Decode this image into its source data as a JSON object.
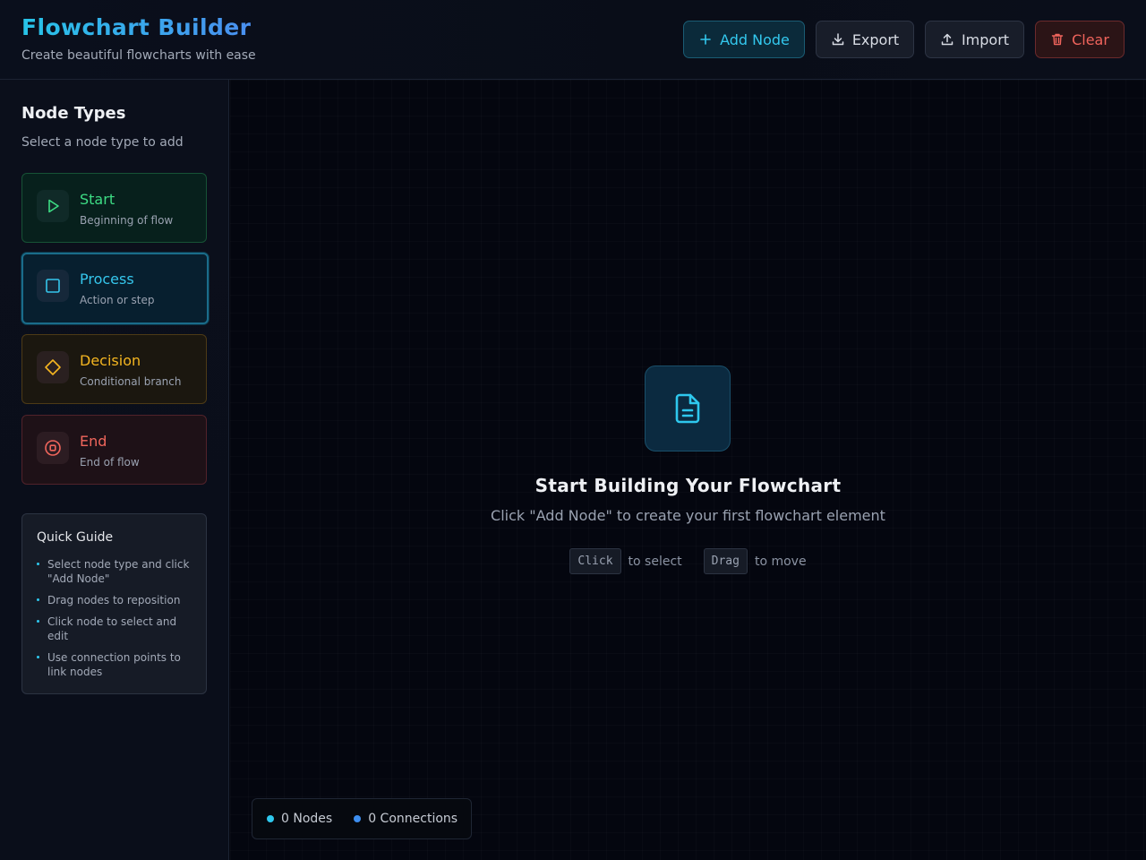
{
  "header": {
    "title": "Flowchart Builder",
    "subtitle": "Create beautiful flowcharts with ease",
    "buttons": {
      "add": "Add Node",
      "export": "Export",
      "import": "Import",
      "clear": "Clear"
    }
  },
  "sidebar": {
    "title": "Node Types",
    "subtitle": "Select a node type to add",
    "node_types": [
      {
        "label": "Start",
        "description": "Beginning of flow",
        "icon": "play-icon",
        "color": "#3ddc84"
      },
      {
        "label": "Process",
        "description": "Action or step",
        "icon": "square-icon",
        "color": "#35c6ec",
        "selected": true
      },
      {
        "label": "Decision",
        "description": "Conditional branch",
        "icon": "diamond-icon",
        "color": "#f4b520"
      },
      {
        "label": "End",
        "description": "End of flow",
        "icon": "stop-circle-icon",
        "color": "#f0665c"
      }
    ],
    "guide": {
      "title": "Quick Guide",
      "items": [
        "Select node type and click \"Add Node\"",
        "Drag nodes to reposition",
        "Click node to select and edit",
        "Use connection points to link nodes"
      ]
    }
  },
  "canvas": {
    "empty_icon": "file-text-icon",
    "empty_title": "Start Building Your Flowchart",
    "empty_subtitle": "Click \"Add Node\" to create your first flowchart element",
    "hints": {
      "click_key": "Click",
      "click_text": "to select",
      "drag_key": "Drag",
      "drag_text": "to move"
    }
  },
  "status": {
    "nodes": "0 Nodes",
    "connections": "0 Connections",
    "nodes_color": "#2ec8ee",
    "connections_color": "#3d8ef0"
  }
}
